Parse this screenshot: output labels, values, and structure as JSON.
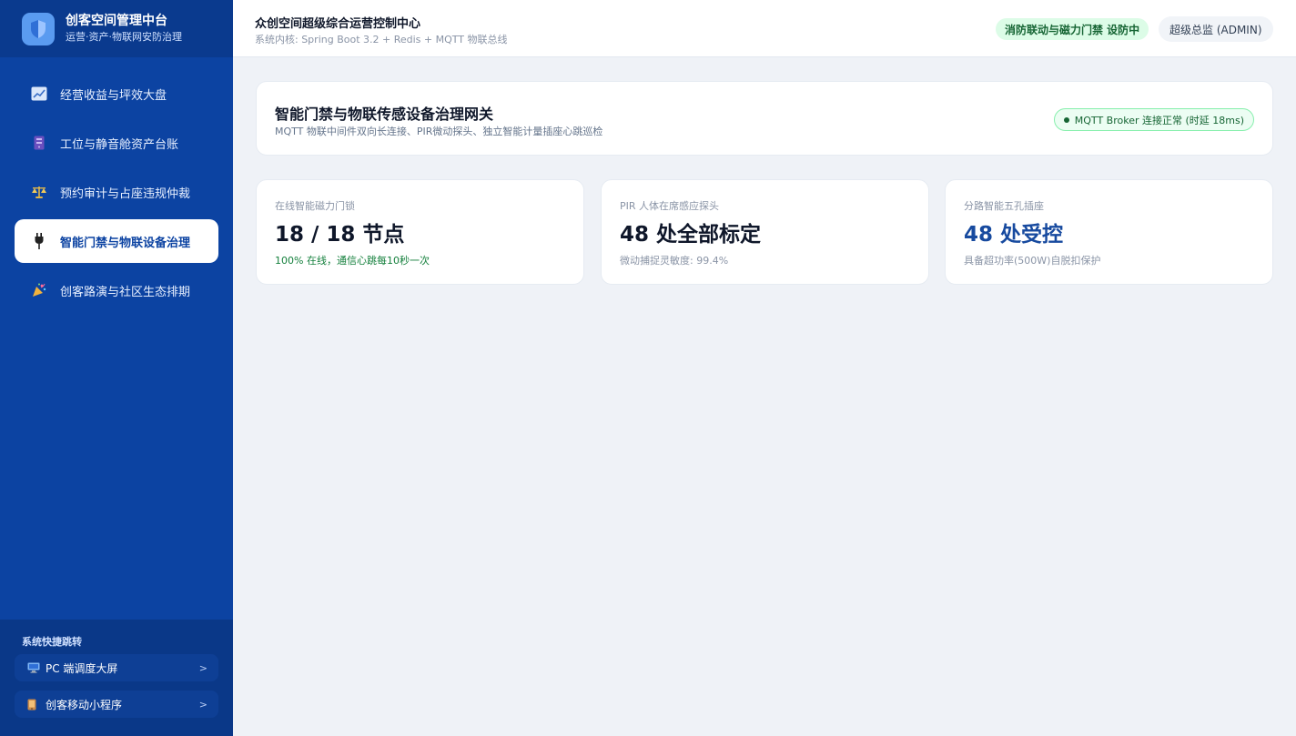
{
  "brand": {
    "title": "创客空间管理中台",
    "subtitle": "运营·资产·物联网安防治理",
    "logo_icon": "shield-icon"
  },
  "sidebar": {
    "items": [
      {
        "label": "经营收益与坪效大盘",
        "icon": "trend-chart-icon",
        "active": false
      },
      {
        "label": "工位与静音舱资产台账",
        "icon": "booth-icon",
        "active": false
      },
      {
        "label": "预约审计与占座违规仲裁",
        "icon": "scales-icon",
        "active": false
      },
      {
        "label": "智能门禁与物联设备治理",
        "icon": "plug-icon",
        "active": true
      },
      {
        "label": "创客路演与社区生态排期",
        "icon": "party-popper-icon",
        "active": false
      }
    ]
  },
  "quick_links": {
    "title": "系统快捷跳转",
    "items": [
      {
        "label": "PC 端调度大屏",
        "icon": "desktop-icon",
        "chevron": ">"
      },
      {
        "label": "创客移动小程序",
        "icon": "mobile-icon",
        "chevron": ">"
      }
    ]
  },
  "header": {
    "title": "众创空间超级综合运营控制中心",
    "subtitle": "系统内核: Spring Boot 3.2 + Redis + MQTT 物联总线",
    "status_badge": "消防联动与磁力门禁 设防中",
    "user": "超级总监 (ADMIN)"
  },
  "panel": {
    "title": "智能门禁与物联传感设备治理网关",
    "subtitle": "MQTT 物联中间件双向长连接、PIR微动探头、独立智能计量插座心跳巡检",
    "status": "MQTT Broker 连接正常 (时延 18ms)"
  },
  "cards": [
    {
      "label": "在线智能磁力门锁",
      "value": "18 / 18 节点",
      "note": "100% 在线，通信心跳每10秒一次"
    },
    {
      "label": "PIR 人体在席感应探头",
      "value": "48 处全部标定",
      "note": "微动捕捉灵敏度: 99.4%"
    },
    {
      "label": "分路智能五孔插座",
      "value": "48 处受控",
      "note": "具备超功率(500W)自脱扣保护"
    }
  ],
  "colors": {
    "sidebar_bg": "#0c43a2",
    "accent_blue": "#174a9f",
    "success_green": "#15803d",
    "badge_green_bg": "#dcfce7"
  }
}
